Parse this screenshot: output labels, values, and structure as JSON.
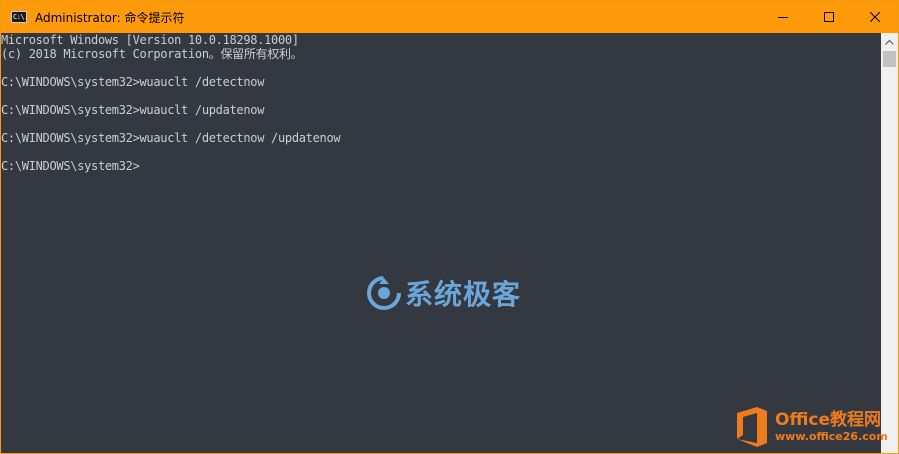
{
  "window": {
    "title": "Administrator: 命令提示符",
    "app_icon_text": "C:\\.",
    "controls": {
      "minimize_icon": "minimize-icon",
      "maximize_icon": "maximize-icon",
      "close_icon": "close-icon"
    }
  },
  "console": {
    "lines": [
      "Microsoft Windows [Version 10.0.18298.1000]",
      "(c) 2018 Microsoft Corporation。保留所有权利。",
      "",
      "C:\\WINDOWS\\system32>wuauclt /detectnow",
      "",
      "C:\\WINDOWS\\system32>wuauclt /updatenow",
      "",
      "C:\\WINDOWS\\system32>wuauclt /detectnow /updatenow",
      "",
      "C:\\WINDOWS\\system32>"
    ]
  },
  "watermarks": {
    "center_text": "系统极客",
    "corner_title": "Office教程网",
    "corner_url": "www.office26.com"
  },
  "colors": {
    "titlebar": "#ff9a0a",
    "console_bg": "#343841",
    "console_text": "#cdcdcd",
    "watermark_blue": "#6aa7d8",
    "watermark_orange": "#f07b1d"
  }
}
